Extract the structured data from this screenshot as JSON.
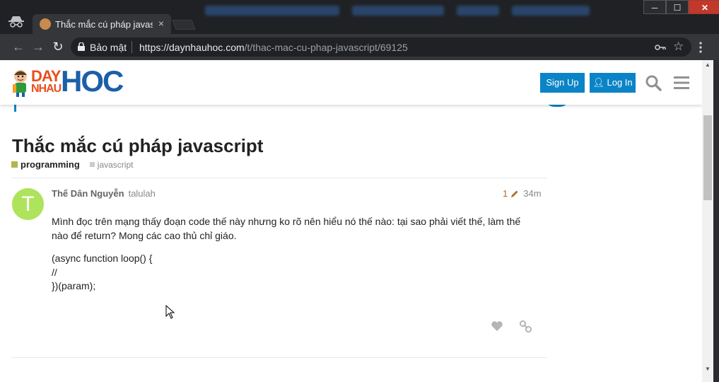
{
  "browser": {
    "tab_title": "Thắc mắc cú pháp javascript - DayNhauHoc",
    "tab_close": "×",
    "security_label": "Bảo mật",
    "url_host": "https://daynhauhoc.com",
    "url_path": "/t/thac-mac-cu-phap-javascript/69125",
    "window_minimize": "─",
    "window_maximize": "☐",
    "window_close": "✕"
  },
  "site": {
    "logo_day": "DAY",
    "logo_nhau": "NHAU",
    "logo_hoc": "HOC",
    "signup_label": "Sign Up",
    "login_label": "Log In"
  },
  "topic": {
    "title": "Thắc mắc cú pháp javascript",
    "category": "programming",
    "tag": "javascript"
  },
  "post": {
    "avatar_letter": "T",
    "author_name": "Thế Dân Nguyễn",
    "username": "talulah",
    "edit_count": "1",
    "time": "34m",
    "body": "Mình đọc trên mạng thấy đoạn code thế này nhưng ko rõ nên hiểu nó thế nào: tại sao phải viết thế, làm thế nào để return? Mong các cao thủ chỉ giáo.",
    "code_line_1": "(async function loop() {",
    "code_line_2": "//",
    "code_line_3": "})(param);"
  },
  "colors": {
    "accent": "#0a84c6",
    "category": "#b3b54a",
    "avatar": "#aee35c"
  }
}
